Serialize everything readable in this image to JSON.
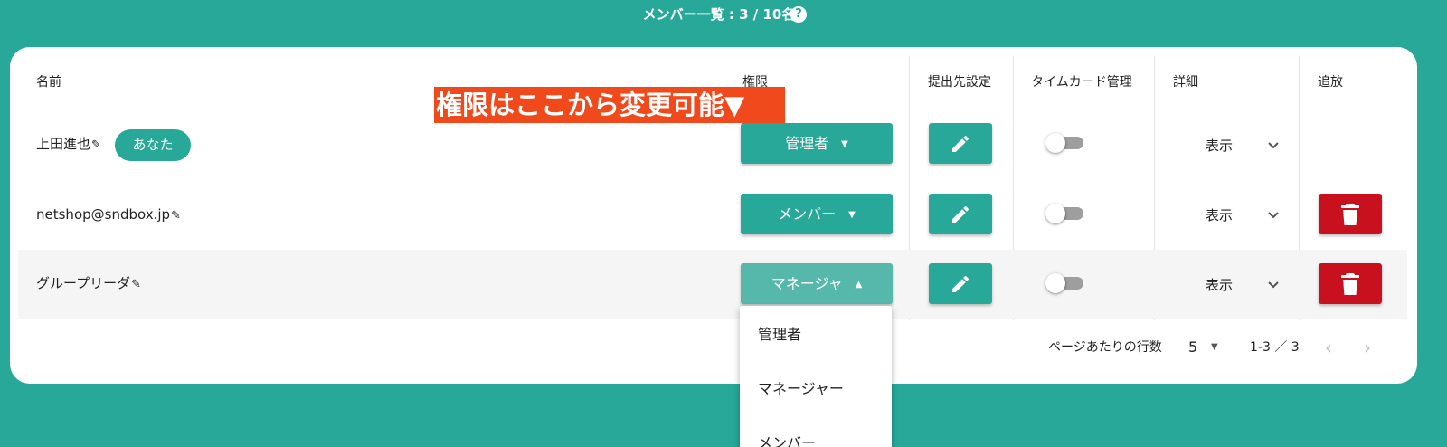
{
  "header": {
    "title": "メンバー一覧 : 3 / 10名",
    "help_icon": "?"
  },
  "columns": {
    "name": "名前",
    "role": "権限",
    "destination": "提出先設定",
    "timecard": "タイムカード管理",
    "detail": "詳細",
    "action": "追放"
  },
  "annotation": "権限はここから変更可能▼",
  "members": [
    {
      "name": "上田進也",
      "you_badge": "あなた",
      "role": "管理者",
      "detail": "表示",
      "timecard_enabled": false
    },
    {
      "name": "netshop@sndbox.jp",
      "role": "メンバー",
      "detail": "表示",
      "timecard_enabled": false
    },
    {
      "name": "グループリーダ",
      "role": "マネージャ",
      "detail": "表示",
      "timecard_enabled": false
    }
  ],
  "pagination": {
    "rows_per_page_label": "ページあたりの行数",
    "rows_per_page": "5",
    "range": "1-3 ／ 3"
  },
  "role_menu": {
    "options": [
      "管理者",
      "マネージャー",
      "メンバー"
    ]
  },
  "colors": {
    "accent": "#27a898",
    "delete": "#c8101f",
    "callout": "#f04a1c"
  },
  "icons": {
    "edit": "pencil-icon",
    "delete": "trash-icon",
    "expand": "chevron-down-icon"
  }
}
